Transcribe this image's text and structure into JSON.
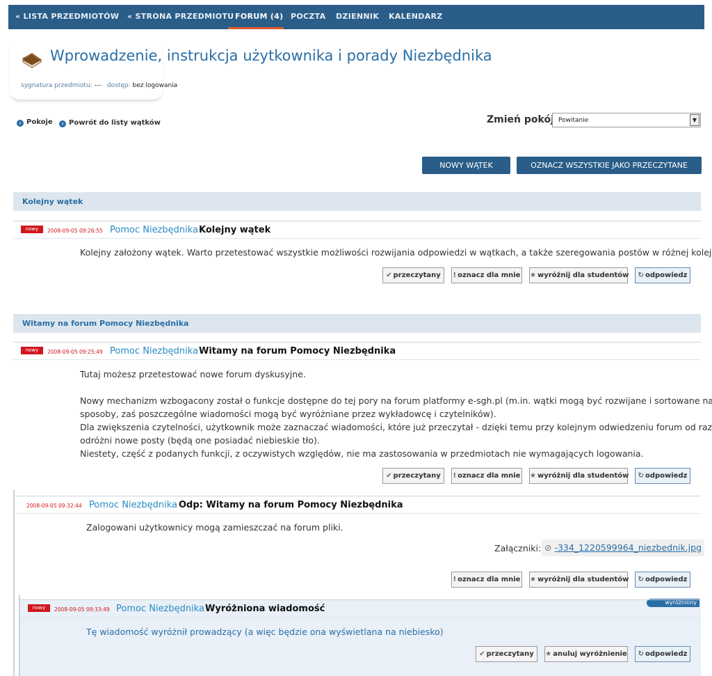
{
  "nav": {
    "items": [
      "« LISTA PRZEDMIOTÓW",
      "« STRONA PRZEDMIOTU",
      "FORUM (4)",
      "POCZTA",
      "DZIENNIK",
      "KALENDARZ"
    ],
    "active_index": 2
  },
  "page": {
    "title": "Wprowadzenie, instrukcja użytkownika i porady Niezbędnika",
    "signature_label": "sygnatura przedmiotu:",
    "signature_value": "---",
    "access_label": "dostęp:",
    "access_value": "bez logowania"
  },
  "links": {
    "rooms": "Pokoje",
    "back": "Powrót do listy wątków"
  },
  "room": {
    "label": "Zmień pokój",
    "selected": "Powitanie"
  },
  "actions": {
    "new_thread": "NOWY WĄTEK",
    "mark_all_read": "OZNACZ WSZYSTKIE JAKO PRZECZYTANE"
  },
  "threads": [
    {
      "title": "Kolejny wątek",
      "posts": [
        {
          "badge": "nowy",
          "date": "2008-09-05 09:26:55",
          "author": "Pomoc Niezbędnika",
          "subject": "Kolejny wątek",
          "body": "Kolejny założony wątek. Warto przetestować wszystkie możliwości rozwijania odpowiedzi w wątkach, a także szeregowania postów w różnej kolejności."
        }
      ]
    },
    {
      "title": "Witamy na forum Pomocy Niezbędnika",
      "posts": [
        {
          "badge": "nowy",
          "date": "2008-09-05 09:25:49",
          "author": "Pomoc Niezbędnika",
          "subject": "Witamy na forum Pomocy Niezbędnika",
          "body_lines": [
            "Tutaj możesz przetestować nowe forum dyskusyjne.",
            "",
            "Nowy mechanizm wzbogacony został o funkcje dostępne do tej pory na forum platformy e-sgh.pl (m.in. wątki mogą być rozwijane i sortowane na różne",
            "sposoby, zaś poszczególne wiadomości mogą być wyróżniane przez wykładowcę i czytelników).",
            "Dla zwiększenia czytelności, użytkownik może zaznaczać wiadomości, które już przeczytał - dzięki temu przy kolejnym odwiedzeniu forum od razu",
            "odróżni nowe posty (będą one posiadać niebieskie tło).",
            "Niestety, część z podanych funkcji, z oczywistych względów, nie ma zastosowania w przedmiotach nie wymagających logowania."
          ]
        },
        {
          "date": "2008-09-05 09:32:44",
          "author": "Pomoc Niezbędnika",
          "subject": "Odp: Witamy na forum Pomocy Niezbędnika",
          "body": "Zalogowani użytkownicy mogą zamieszczać na forum pliki.",
          "attachments_label": "Załączniki:",
          "attachment": "-334_1220599964_niezbednik.jpg"
        },
        {
          "badge": "nowy",
          "date": "2008-09-05 09:33:49",
          "author": "Pomoc Niezbędnika",
          "subject": "Wyróżniona wiadomość",
          "ribbon": "wyróżniony",
          "body": "Tę wiadomość wyróżnił prowadzący (a więc będzie ona wyświetlana na niebiesko)"
        }
      ]
    }
  ],
  "buttons": {
    "read": "przeczytany",
    "mark_me": "oznacz dla mnie",
    "highlight": "wyróżnij dla studentów",
    "reply": "odpowiedz",
    "cancel_highlight": "anuluj wyróżnienie"
  },
  "colors": {
    "nav_bg": "#2a5d88",
    "accent": "#e35b2b",
    "new_badge": "#d0171d",
    "link": "#2a8ac6"
  }
}
